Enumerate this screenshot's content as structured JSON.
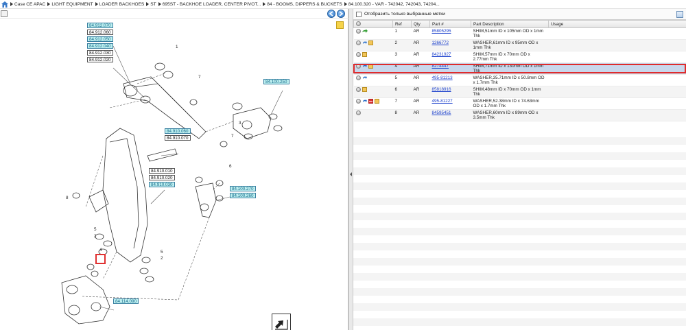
{
  "breadcrumb": [
    "Case CE APAC",
    "LIGHT EQUIPMENT",
    "LOADER BACKHOES",
    "ST",
    "695ST - BACKHOE LOADER, CENTER PIVOT...",
    "84 - BOOMS, DIPPERS & BUCKETS",
    "84.100.320 - VAR - 742042, 742043, 74204..."
  ],
  "diagram": {
    "callouts": [
      {
        "id": "c1",
        "text": "84.912.070",
        "hl": true
      },
      {
        "id": "c2",
        "text": "84.912.060",
        "hl": false
      },
      {
        "id": "c3",
        "text": "84.912.050",
        "hl": true
      },
      {
        "id": "c4",
        "text": "84.912.040",
        "hl": true
      },
      {
        "id": "c5",
        "text": "84.912.030",
        "hl": false
      },
      {
        "id": "c6",
        "text": "84.912.020",
        "hl": false
      },
      {
        "id": "c7",
        "text": "84.100.250",
        "hl": true
      },
      {
        "id": "c8",
        "text": "84.910.060",
        "hl": true
      },
      {
        "id": "c9",
        "text": "84.910.070",
        "hl": false
      },
      {
        "id": "c10",
        "text": "84.910.010",
        "hl": false
      },
      {
        "id": "c11",
        "text": "84.910.020",
        "hl": false
      },
      {
        "id": "c12",
        "text": "84.910.030",
        "hl": true
      },
      {
        "id": "c13",
        "text": "84.100.270",
        "hl": true
      },
      {
        "id": "c14",
        "text": "84.100.260",
        "hl": true
      },
      {
        "id": "c15",
        "text": "84.114.090",
        "hl": true
      }
    ],
    "ref_numbers": {
      "n1a": "1",
      "n7a": "7",
      "n3": "3",
      "n7b": "7",
      "n6": "6",
      "n8": "8",
      "n5a": "5",
      "n2a": "2",
      "n4": "4",
      "n5b": "5",
      "n2b": "2"
    }
  },
  "right_panel": {
    "filter_label": "Отобразить только выбранные метки",
    "columns": [
      "Ref",
      "Qty",
      "Part #",
      "Part Description",
      "Usage"
    ],
    "rows": [
      {
        "ref": "1",
        "qty": "AR",
        "part": "85805295",
        "desc": "SHIM,51mm ID x 105mm OD x 1mm Thk",
        "usage": "",
        "icons": [
          "info",
          "green-arrow"
        ]
      },
      {
        "ref": "2",
        "qty": "AR",
        "part": "1266772",
        "desc": "WASHER,61mm ID x 95mm OD x 1mm Thk",
        "usage": "",
        "icons": [
          "info",
          "arrow",
          "box"
        ]
      },
      {
        "ref": "3",
        "qty": "AR",
        "part": "84231927",
        "desc": "SHIM,57mm ID x 70mm OD x 2.77mm Thk",
        "usage": "",
        "icons": [
          "info",
          "box"
        ]
      },
      {
        "ref": "4",
        "qty": "AR",
        "part": "8274447",
        "desc": "SHIM,71mm ID x 130mm OD x 1mm Thk",
        "usage": "",
        "icons": [
          "info",
          "arrow",
          "box"
        ],
        "selected": true
      },
      {
        "ref": "5",
        "qty": "AR",
        "part": "495-81213",
        "desc": "WASHER,35.71mm ID x 50.8mm OD x 1.7mm Thk",
        "usage": "",
        "icons": [
          "info",
          "arrow"
        ]
      },
      {
        "ref": "6",
        "qty": "AR",
        "part": "85818916",
        "desc": "SHIM,48mm ID x 70mm OD x 1mm Thk",
        "usage": "",
        "icons": [
          "info",
          "box"
        ]
      },
      {
        "ref": "7",
        "qty": "AR",
        "part": "495-81227",
        "desc": "WASHER,52.38mm ID x 74.63mm OD x 1.7mm Thk",
        "usage": "",
        "icons": [
          "info",
          "arrow",
          "red",
          "box"
        ]
      },
      {
        "ref": "8",
        "qty": "AR",
        "part": "84595451",
        "desc": "WASHER,60mm ID x 89mm OD x 3.5mm Thk",
        "usage": "",
        "icons": [
          "info"
        ]
      }
    ]
  },
  "colors": {
    "link": "#1a3fcc",
    "highlight": "#bdeff0",
    "selected_row": "#c9d8ec",
    "selection_border": "#e02c2c"
  }
}
